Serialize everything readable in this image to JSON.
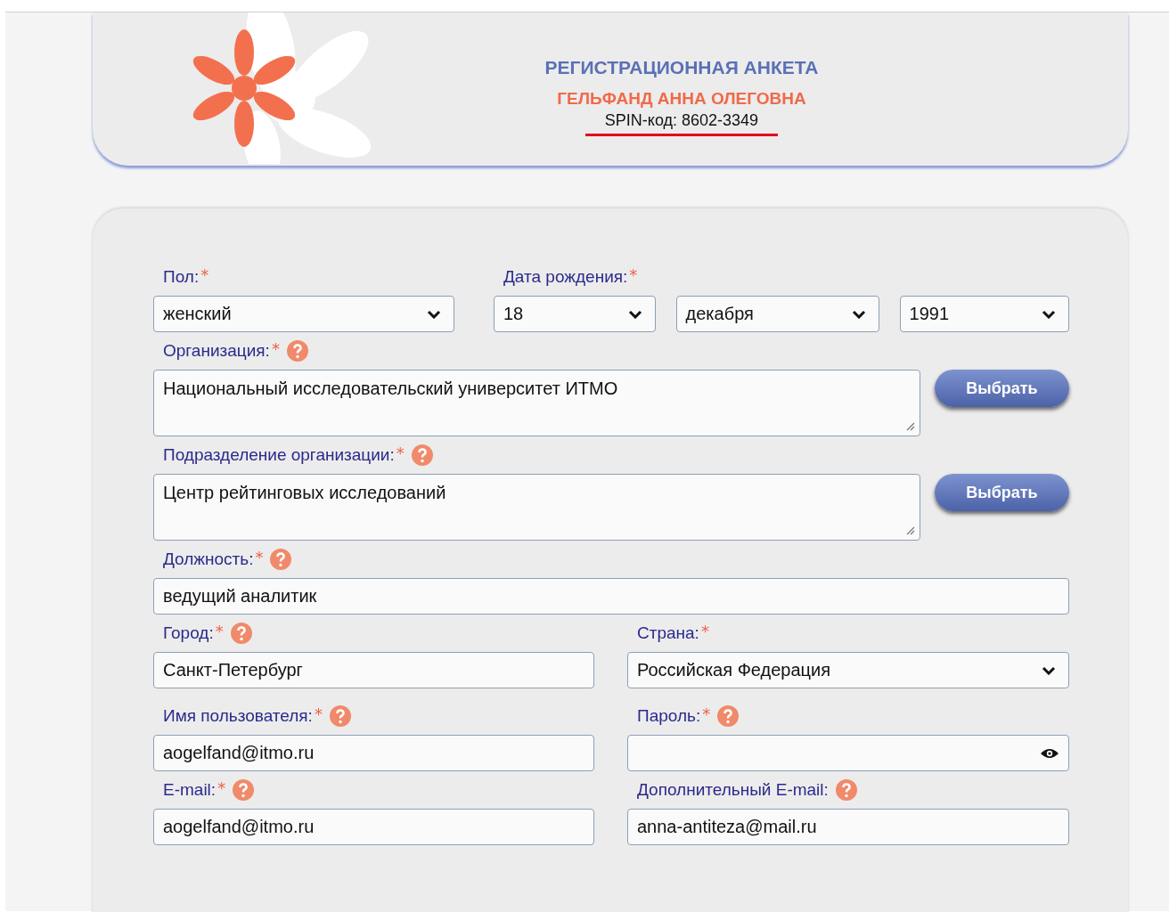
{
  "header": {
    "title": "РЕГИСТРАЦИОННАЯ АНКЕТА",
    "name": "ГЕЛЬФАНД АННА ОЛЕГОВНА",
    "spin": "SPIN-код: 8602-3349"
  },
  "rows": [
    {
      "cells": [
        {
          "label": "Пол:",
          "mark": "*",
          "help": false,
          "controls": [
            {
              "kind": "select",
              "value": "женский"
            }
          ]
        },
        {
          "label": "Дата рождения:",
          "mark": "*",
          "help": false,
          "controls": [
            {
              "kind": "select",
              "value": "18"
            },
            {
              "kind": "select",
              "value": "декабря"
            },
            {
              "kind": "select",
              "value": "1991"
            }
          ]
        }
      ]
    },
    {
      "cells": [
        {
          "label": "Организация:",
          "mark": "*",
          "help": true,
          "controls": [
            {
              "kind": "textarea",
              "value": "Национальный исследовательский университет ИТМО"
            }
          ],
          "button": "Выбрать"
        }
      ]
    },
    {
      "cells": [
        {
          "label": "Подразделение организации:",
          "mark": "*",
          "help": true,
          "controls": [
            {
              "kind": "textarea",
              "value": "Центр рейтинговых исследований"
            }
          ],
          "button": "Выбрать"
        }
      ]
    },
    {
      "cells": [
        {
          "label": "Должность:",
          "mark": "*",
          "help": true,
          "controls": [
            {
              "kind": "input",
              "value": "ведущий аналитик"
            }
          ]
        }
      ]
    },
    {
      "cells": [
        {
          "label": "Город:",
          "mark": "*",
          "help": true,
          "controls": [
            {
              "kind": "input",
              "value": "Санкт-Петербург"
            }
          ]
        },
        {
          "label": "Страна:",
          "mark": "*",
          "help": false,
          "controls": [
            {
              "kind": "select",
              "value": "Российская Федерация"
            }
          ]
        }
      ]
    },
    {
      "cells": [
        {
          "label": "Имя пользователя:",
          "mark": "*",
          "help": true,
          "controls": [
            {
              "kind": "input",
              "value": "aogelfand@itmo.ru"
            }
          ]
        },
        {
          "label": "Пароль:",
          "mark": "*",
          "help": true,
          "controls": [
            {
              "kind": "password"
            }
          ]
        }
      ]
    },
    {
      "cells": [
        {
          "label": "E-mail:",
          "mark": "*",
          "help": true,
          "controls": [
            {
              "kind": "input",
              "value": "aogelfand@itmo.ru"
            }
          ]
        },
        {
          "label": "Дополнительный E-mail:",
          "help": true,
          "controls": [
            {
              "kind": "input",
              "value": "anna-antiteza@mail.ru"
            }
          ]
        }
      ]
    }
  ]
}
